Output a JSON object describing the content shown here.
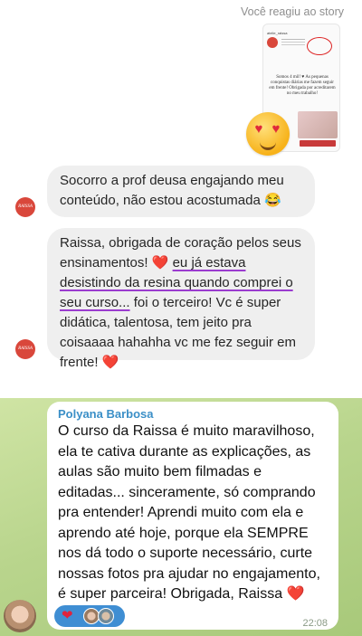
{
  "instagram": {
    "reaction_caption": "Você reagiu ao story",
    "story_thumbnail": {
      "text": "Somos 4 mil! ♥ As pequenas conquistas diárias me fazem seguir em frente! Obrigada por acreditarem no meu trabalho!"
    },
    "reaction_emoji": "heart-eyes-emoji",
    "messages": [
      {
        "text": "Socorro a prof deusa engajando meu conteúdo, não estou acostumada 😂"
      },
      {
        "part1": "Raissa, obrigada de coração pelos seus ensinamentos! ",
        "heart": "❤️",
        "underlined": "eu já estava desistindo da resina quando comprei o seu curso...",
        "part2": " foi o terceiro! Vc é super didática, talentosa, tem jeito pra coisaaaa hahahha vc me fez seguir em frente! ",
        "heart2": "❤️"
      }
    ],
    "avatar_label": "RAISSA"
  },
  "telegram": {
    "sender_name": "Polyana Barbosa",
    "message": "O curso da Raissa é muito maravilhoso, ela te cativa durante as explicações, as aulas são muito bem filmadas e editadas... sinceramente, só comprando pra entender! Aprendi muito com ela e aprendo até hoje, porque ela SEMPRE nos dá todo o suporte necessário, curte nossas fotos pra ajudar no engajamento, é super parceira! Obrigada, Raissa ❤️",
    "reaction_heart": "❤",
    "time": "22:08"
  },
  "colors": {
    "telegram_name": "#3b8fc7",
    "reaction_pill": "#3f8ed3",
    "heart": "#e0233c",
    "underline": "#9b3ccf"
  }
}
